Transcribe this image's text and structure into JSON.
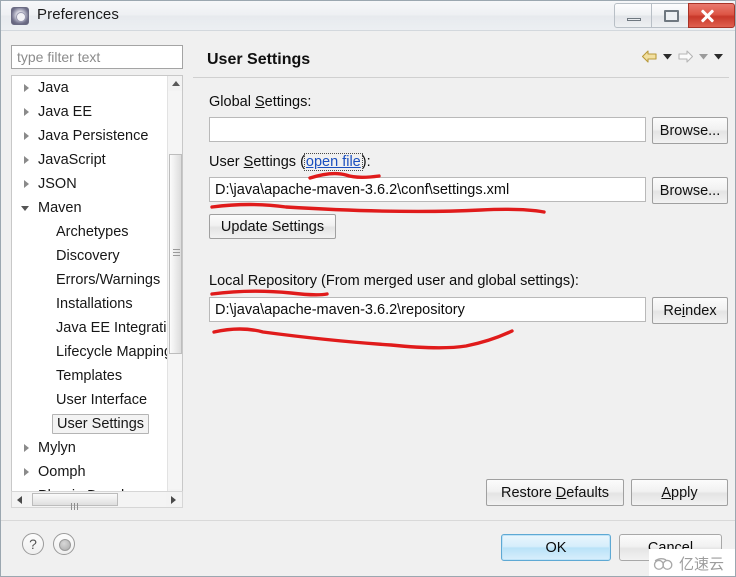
{
  "window": {
    "title": "Preferences",
    "icon": "preferences-gear-icon",
    "controls": {
      "minimize": "minimize-icon",
      "restore": "restore-icon",
      "close": "close-icon"
    }
  },
  "filter": {
    "placeholder": "type filter text",
    "value": ""
  },
  "tree": {
    "items": [
      {
        "label": "Java",
        "level": 0,
        "state": "collapsed",
        "selected": false
      },
      {
        "label": "Java EE",
        "level": 0,
        "state": "collapsed",
        "selected": false
      },
      {
        "label": "Java Persistence",
        "level": 0,
        "state": "collapsed",
        "selected": false
      },
      {
        "label": "JavaScript",
        "level": 0,
        "state": "collapsed",
        "selected": false
      },
      {
        "label": "JSON",
        "level": 0,
        "state": "collapsed",
        "selected": false
      },
      {
        "label": "Maven",
        "level": 0,
        "state": "expanded",
        "selected": false
      },
      {
        "label": "Archetypes",
        "level": 1,
        "state": "leaf",
        "selected": false
      },
      {
        "label": "Discovery",
        "level": 1,
        "state": "leaf",
        "selected": false
      },
      {
        "label": "Errors/Warnings",
        "level": 1,
        "state": "leaf",
        "selected": false
      },
      {
        "label": "Installations",
        "level": 1,
        "state": "leaf",
        "selected": false
      },
      {
        "label": "Java EE Integration",
        "level": 1,
        "state": "leaf",
        "selected": false
      },
      {
        "label": "Lifecycle Mappings",
        "level": 1,
        "state": "leaf",
        "selected": false
      },
      {
        "label": "Templates",
        "level": 1,
        "state": "leaf",
        "selected": false
      },
      {
        "label": "User Interface",
        "level": 1,
        "state": "leaf",
        "selected": false
      },
      {
        "label": "User Settings",
        "level": 1,
        "state": "leaf",
        "selected": true
      },
      {
        "label": "Mylyn",
        "level": 0,
        "state": "collapsed",
        "selected": false
      },
      {
        "label": "Oomph",
        "level": 0,
        "state": "collapsed",
        "selected": false
      },
      {
        "label": "Plug-in Development",
        "level": 0,
        "state": "collapsed",
        "selected": false
      }
    ]
  },
  "page": {
    "title": "User Settings",
    "nav": {
      "back": "back-arrow-icon",
      "back_menu": "back-dropdown-icon",
      "forward": "forward-arrow-icon",
      "forward_menu": "forward-dropdown-icon",
      "view_menu": "view-menu-icon"
    },
    "global_settings": {
      "label": "Global Settings:",
      "label_mnemonic": "S",
      "value": "",
      "browse_label": "Browse..."
    },
    "user_settings": {
      "label_prefix": "User ",
      "label_mnemonic": "S",
      "label_middle": "ettings (",
      "link": "open file",
      "label_suffix": "):",
      "value": "D:\\java\\apache-maven-3.6.2\\conf\\settings.xml",
      "browse_label": "Browse...",
      "update_label": "Update Settings"
    },
    "local_repository": {
      "label": "Local Repository (From merged user and global settings):",
      "value": "D:\\java\\apache-maven-3.6.2\\repository",
      "reindex_label_prefix": "Re",
      "reindex_mnemonic": "i",
      "reindex_label_suffix": "ndex"
    },
    "restore_defaults": {
      "prefix": "Restore ",
      "mnemonic": "D",
      "suffix": "efaults"
    },
    "apply": {
      "prefix": "",
      "mnemonic": "A",
      "suffix": "pply"
    }
  },
  "footer": {
    "help_icon": "help-question-icon",
    "secondary_icon": "circle-dot-icon",
    "ok_label": "OK",
    "cancel_label": "Cancel"
  },
  "annotations": {
    "color": "#e01b1b",
    "marks": [
      "underline-open-file-link",
      "underline-user-settings-path",
      "underline-local-repository-label",
      "underline-local-repository-path"
    ]
  },
  "watermark": {
    "text": "亿速云",
    "logo": "cloud-logo-icon"
  }
}
